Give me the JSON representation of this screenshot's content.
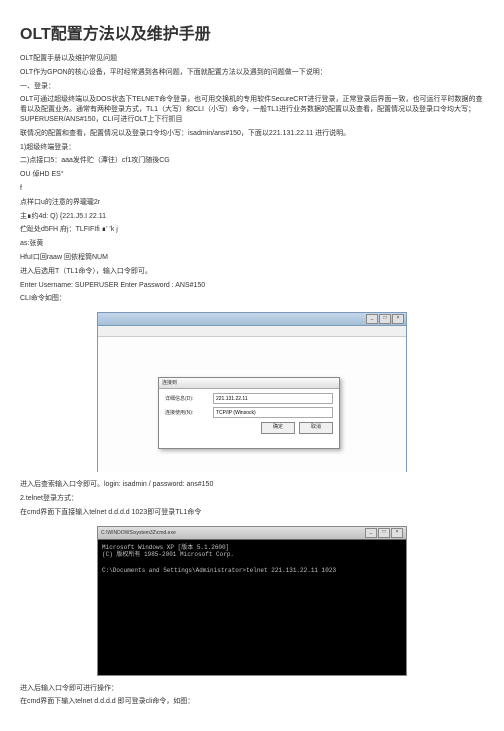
{
  "title": "OLT配置方法以及维护手册",
  "p1": "OLT配置手册以及维护常见问题",
  "p2": "OLT作为GPON的核心设备，平时经常遇到各种问题，下面就配置方法以及遇到的问题做一下说明：",
  "sec1": "一、登录：",
  "p3": "OLT可通过超级终端以及DOS状态下TELNET命令登录，也可用交换机的专用软件SecureCRT进行登录，正常登录后界面一致，也可运行平时数据的查看以及配置业务。通常有两种登录方式，TL1（大写）和CLI（小写）命令，一般TL1进行业务数据的配置以及查看，配置情况以及登录口令均大写；SUPERUSER/ANS#150，CLI可进行OLT上下行抓目",
  "p4": "联情况的配置和查看，配置情况以及登录口令均小写：isadmin/ans#150，下面以221.131.22.11 进行说明。",
  "p5": "1)超级终端登录：",
  "p6": "二)点接口5：aaa发件贮（潭往）cf1攻门随後CG",
  "p7": "OU 倬HD ES°",
  "p8": "f",
  "p9": "点样口u的注意的界瓏瓏2r",
  "p10": "主∎约4d: Q) {221.J5.I 22.11",
  "p11": "伫趾处d5FH 府j：TLFIFIfi ∎' 'k j",
  "p12": "as:张黄",
  "p13": "HfuI口回raaw 回依程筒NUM",
  "p14": "进入后选用T（TL1命令），输入口令即可。",
  "p15": "Enter Username: SUPERUSER Enter Password : ANS#150",
  "p16": "CLI命令如图：",
  "dialog": {
    "title": "连接到",
    "row1_label": "详细信息(D):",
    "row1_value": "221.131.22.11",
    "row2_label": "连接使用(N):",
    "row2_value": "TCP/IP (Winsock)",
    "ok": "确定",
    "cancel": "取消"
  },
  "p17": "进入后查索输入口令即可。login: isadmin / password: ans#150",
  "p18": "2.telnet登录方式：",
  "p19": "在cmd界面下直接输入telnet d.d.d.d 1023即可登录TL1命令",
  "term": {
    "titlebar": "C:\\WINDOWS\\system32\\cmd.exe",
    "line1": "Microsoft Windows XP [版本 5.1.2600]",
    "line2": "(C) 版权所有 1985-2001 Microsoft Corp.",
    "line3": "C:\\Documents and Settings\\Administrator>telnet 221.131.22.11 1023"
  },
  "p20": "进入后输入口令即可进行操作：",
  "p21": "在cmd界面下输入telnet d.d.d.d 即可登录cli命令，如图："
}
